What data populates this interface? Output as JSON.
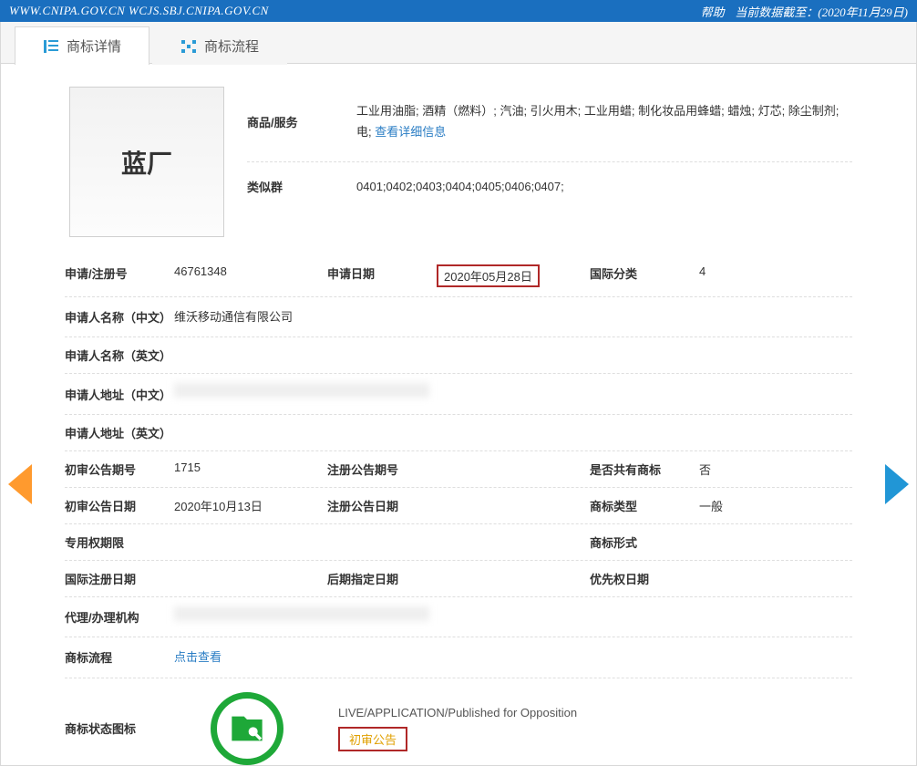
{
  "topbar": {
    "urls": "WWW.CNIPA.GOV.CN WCJS.SBJ.CNIPA.GOV.CN",
    "help": "帮助",
    "data_until": "当前数据截至：(2020年11月29日)"
  },
  "tabs": {
    "detail": "商标详情",
    "flow": "商标流程"
  },
  "mark": {
    "name": "蓝厂",
    "goods_label": "商品/服务",
    "goods_value": "工业用油脂; 酒精（燃料）; 汽油; 引火用木; 工业用蜡; 制化妆品用蜂蜡; 蜡烛; 灯芯; 除尘制剂; 电;",
    "goods_more": "查看详细信息",
    "similar_label": "类似群",
    "similar_value": "0401;0402;0403;0404;0405;0406;0407;"
  },
  "fields": {
    "regno_l": "申请/注册号",
    "regno_v": "46761348",
    "appdate_l": "申请日期",
    "appdate_v": "2020年05月28日",
    "intlcls_l": "国际分类",
    "intlcls_v": "4",
    "applicant_cn_l": "申请人名称（中文）",
    "applicant_cn_v": "维沃移动通信有限公司",
    "applicant_en_l": "申请人名称（英文）",
    "applicant_en_v": "",
    "addr_cn_l": "申请人地址（中文）",
    "addr_cn_v": "",
    "addr_en_l": "申请人地址（英文）",
    "addr_en_v": "",
    "prelim_no_l": "初审公告期号",
    "prelim_no_v": "1715",
    "reg_ann_no_l": "注册公告期号",
    "reg_ann_no_v": "",
    "shared_l": "是否共有商标",
    "shared_v": "否",
    "prelim_date_l": "初审公告日期",
    "prelim_date_v": "2020年10月13日",
    "reg_ann_date_l": "注册公告日期",
    "reg_ann_date_v": "",
    "type_l": "商标类型",
    "type_v": "一般",
    "excl_l": "专用权期限",
    "excl_v": "",
    "form_l": "商标形式",
    "form_v": "",
    "intlreg_l": "国际注册日期",
    "intlreg_v": "",
    "later_l": "后期指定日期",
    "later_v": "",
    "prio_l": "优先权日期",
    "prio_v": "",
    "agent_l": "代理/办理机构",
    "agent_v": "",
    "flow_l": "商标流程",
    "flow_link": "点击查看",
    "status_l": "商标状态图标",
    "status_title": "LIVE/APPLICATION/Published for Opposition",
    "status_sub": "初审公告"
  }
}
